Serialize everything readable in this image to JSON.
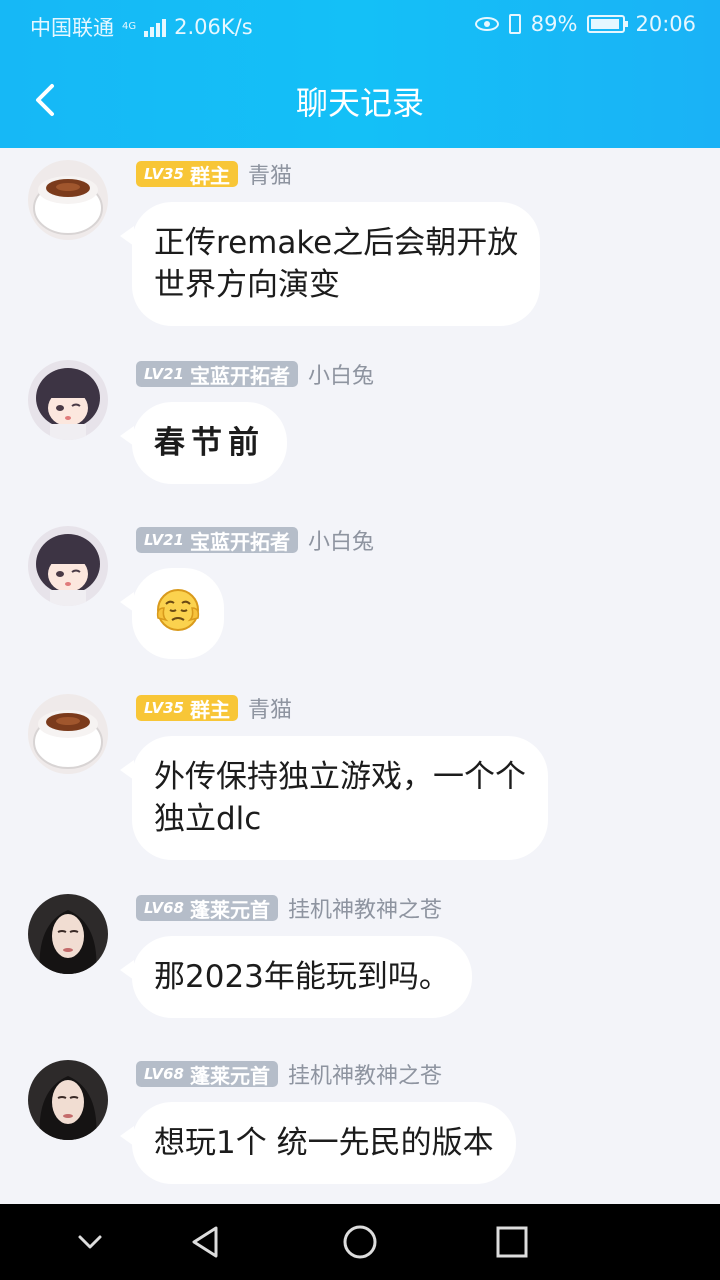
{
  "status": {
    "carrier": "中国联通",
    "network_small": "4G",
    "speed": "2.06K/s",
    "battery_pct": "89%",
    "time": "20:06"
  },
  "header": {
    "title": "聊天记录"
  },
  "messages": [
    {
      "level": "LV35",
      "role": "群主",
      "badge_color": "#f8c637",
      "name": "青猫",
      "text": "正传remake之后会朝开放\n世界方向演变",
      "avatar": "coffee-cup-avatar"
    },
    {
      "level": "LV21",
      "role": "宝蓝开拓者",
      "badge_color": "#b5bdc9",
      "name": "小白兔",
      "text": "春节前",
      "avatar": "anime-girl-avatar"
    },
    {
      "level": "LV21",
      "role": "宝蓝开拓者",
      "badge_color": "#b5bdc9",
      "name": "小白兔",
      "text": "",
      "avatar": "anime-girl-avatar",
      "emoji": "worried-face-emoji"
    },
    {
      "level": "LV35",
      "role": "群主",
      "badge_color": "#f8c637",
      "name": "青猫",
      "text": "外传保持独立游戏，一个个\n独立dlc",
      "avatar": "coffee-cup-avatar"
    },
    {
      "level": "LV68",
      "role": "蓬莱元首",
      "badge_color": "#b5bdc9",
      "name": "挂机神教神之苍",
      "text": "那2023年能玩到吗。",
      "avatar": "woman-photo-avatar"
    },
    {
      "level": "LV68",
      "role": "蓬莱元首",
      "badge_color": "#b5bdc9",
      "name": "挂机神教神之苍",
      "text": "想玩1个 统一先民的版本",
      "avatar": "woman-photo-avatar"
    }
  ]
}
